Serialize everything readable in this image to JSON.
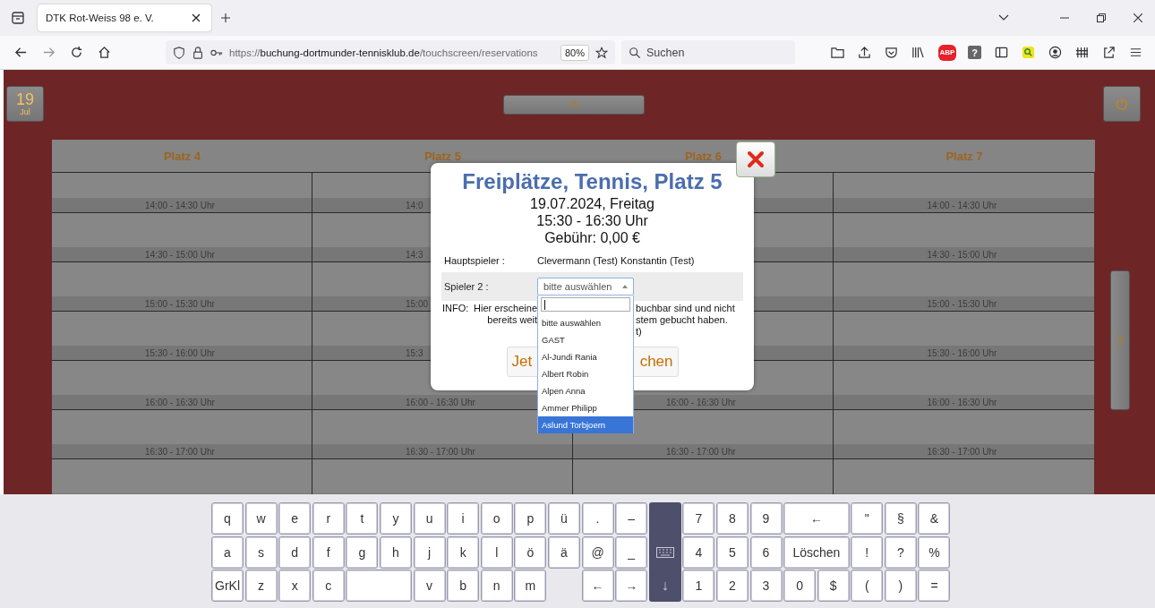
{
  "browser": {
    "tab_title": "DTK Rot-Weiss 98 e. V.",
    "url": {
      "scheme": "https://",
      "host": "buchung-dortmunder-tennisklub.de",
      "path": "/touchscreen/reservations"
    },
    "zoom": "80%",
    "search_placeholder": "Suchen",
    "extensions": [
      {
        "kind": "abp",
        "label": "ABP"
      },
      {
        "kind": "help",
        "label": "?"
      }
    ]
  },
  "date_button": {
    "day": "19",
    "month": "Jul"
  },
  "courts": [
    {
      "name": "Platz 4",
      "slots": [
        {
          "kind": "labeled",
          "label": "14:00 - 14:30 Uhr"
        },
        {
          "kind": "labeled",
          "label": "14:30 - 15:00 Uhr"
        },
        {
          "kind": "labeled",
          "label": "15:00 - 15:30 Uhr"
        },
        {
          "kind": "labeled",
          "label": "15:30 - 16:00 Uhr"
        },
        {
          "kind": "labeled",
          "label": "16:00 - 16:30 Uhr"
        },
        {
          "kind": "labeled",
          "label": "16:30 - 17:00 Uhr"
        },
        {
          "kind": "empty"
        }
      ]
    },
    {
      "name": "Platz 5",
      "slots": [
        {
          "kind": "labeled",
          "label": "14:0"
        },
        {
          "kind": "labeled",
          "label": "14:3"
        },
        {
          "kind": "labeled",
          "label": "15:00"
        },
        {
          "kind": "labeled",
          "label": "15:3"
        },
        {
          "kind": "labeled",
          "label": "16:00 - 16:30 Uhr"
        },
        {
          "kind": "labeled",
          "label": "16:30 - 17:00 Uhr"
        },
        {
          "kind": "empty"
        }
      ]
    },
    {
      "name": "Platz 6",
      "slots": [
        {
          "kind": "empty"
        },
        {
          "kind": "empty"
        },
        {
          "kind": "empty"
        },
        {
          "kind": "empty"
        },
        {
          "kind": "labeled",
          "label": "16:00 - 16:30 Uhr"
        },
        {
          "kind": "labeled",
          "label": "16:30 - 17:00 Uhr"
        },
        {
          "kind": "empty"
        }
      ]
    },
    {
      "name": "Platz 7",
      "slots": [
        {
          "kind": "labeled",
          "label": "14:00 - 14:30 Uhr"
        },
        {
          "kind": "labeled",
          "label": "14:30 - 15:00 Uhr"
        },
        {
          "kind": "labeled",
          "label": "15:00 - 15:30 Uhr"
        },
        {
          "kind": "labeled",
          "label": "15:30 - 16:00 Uhr"
        },
        {
          "kind": "labeled",
          "label": "16:00 - 16:30 Uhr"
        },
        {
          "kind": "labeled",
          "label": "16:30 - 17:00 Uhr"
        },
        {
          "kind": "empty"
        }
      ]
    }
  ],
  "booking_dialog": {
    "title": "Freiplätze, Tennis, Platz 5",
    "date": "19.07.2024, Freitag",
    "time": "15:30 - 16:30 Uhr",
    "fee": "Gebühr: 0,00 €",
    "main_player_label": "Hauptspieler :",
    "main_player": "Clevermann (Test) Konstantin (Test)",
    "player2_label": "Spieler 2 :",
    "player2_select": {
      "value": "bitte auswählen",
      "expanded": true,
      "options": [
        {
          "label": "bitte auswählen",
          "highlighted": false
        },
        {
          "label": "GAST",
          "highlighted": false
        },
        {
          "label": "Al-Jundi Rania",
          "highlighted": false
        },
        {
          "label": "Albert Robin",
          "highlighted": false
        },
        {
          "label": "Alpen Anna",
          "highlighted": false
        },
        {
          "label": "Ammer Philipp",
          "highlighted": false
        },
        {
          "label": "Aslund Torbjoern",
          "highlighted": true
        }
      ]
    },
    "info_label": "INFO:",
    "info_fragments": [
      {
        "left": "Hier erscheine",
        "right": "buchbar sind und nicht"
      },
      {
        "left": "bereits weit",
        "right": "stem gebucht haben."
      },
      {
        "right": "t)"
      }
    ],
    "book_button": {
      "left": "Jet",
      "right": "chen"
    }
  },
  "keyboard": {
    "hide_key": {
      "label": "↓"
    },
    "keys": [
      {
        "kind": "key",
        "label": "q"
      },
      {
        "kind": "key",
        "label": "w"
      },
      {
        "kind": "key",
        "label": "e"
      },
      {
        "kind": "key",
        "label": "r"
      },
      {
        "kind": "key",
        "label": "t"
      },
      {
        "kind": "key",
        "label": "y"
      },
      {
        "kind": "key",
        "label": "u"
      },
      {
        "kind": "key",
        "label": "i"
      },
      {
        "kind": "key",
        "label": "o"
      },
      {
        "kind": "key",
        "label": "p"
      },
      {
        "kind": "key",
        "label": "ü"
      },
      {
        "kind": "key",
        "label": "."
      },
      {
        "kind": "key",
        "label": "–"
      },
      {
        "kind": "key",
        "label": "7"
      },
      {
        "kind": "key",
        "label": "8"
      },
      {
        "kind": "key",
        "label": "9"
      },
      {
        "kind": "wide",
        "label": "←"
      },
      {
        "kind": "key",
        "label": "\""
      },
      {
        "kind": "key",
        "label": "§"
      },
      {
        "kind": "key",
        "label": "&"
      },
      {
        "kind": "key",
        "label": "a"
      },
      {
        "kind": "key",
        "label": "s"
      },
      {
        "kind": "key",
        "label": "d"
      },
      {
        "kind": "key",
        "label": "f"
      },
      {
        "kind": "key",
        "label": "g"
      },
      {
        "kind": "key",
        "label": "h"
      },
      {
        "kind": "key",
        "label": "j"
      },
      {
        "kind": "key",
        "label": "k"
      },
      {
        "kind": "key",
        "label": "l"
      },
      {
        "kind": "key",
        "label": "ö"
      },
      {
        "kind": "key",
        "label": "ä"
      },
      {
        "kind": "key",
        "label": "@"
      },
      {
        "kind": "key",
        "label": "_"
      },
      {
        "kind": "key",
        "label": "4"
      },
      {
        "kind": "key",
        "label": "5"
      },
      {
        "kind": "key",
        "label": "6"
      },
      {
        "kind": "wide",
        "label": "Löschen"
      },
      {
        "kind": "key",
        "label": "!"
      },
      {
        "kind": "key",
        "label": "?"
      },
      {
        "kind": "key",
        "label": "%"
      },
      {
        "kind": "key",
        "label": "GrKl"
      },
      {
        "kind": "key",
        "label": "z"
      },
      {
        "kind": "key",
        "label": "x"
      },
      {
        "kind": "key",
        "label": "c"
      },
      {
        "kind": "space"
      },
      {
        "kind": "key",
        "label": "v"
      },
      {
        "kind": "key",
        "label": "b"
      },
      {
        "kind": "key",
        "label": "n"
      },
      {
        "kind": "key",
        "label": "m"
      },
      {
        "kind": "gap"
      },
      {
        "kind": "key",
        "label": "←"
      },
      {
        "kind": "key",
        "label": "→"
      },
      {
        "kind": "key",
        "label": "1"
      },
      {
        "kind": "key",
        "label": "2"
      },
      {
        "kind": "key",
        "label": "3"
      },
      {
        "kind": "key",
        "label": "0"
      },
      {
        "kind": "key",
        "label": "$"
      },
      {
        "kind": "key",
        "label": "("
      },
      {
        "kind": "key",
        "label": ")"
      },
      {
        "kind": "key",
        "label": "="
      }
    ]
  }
}
